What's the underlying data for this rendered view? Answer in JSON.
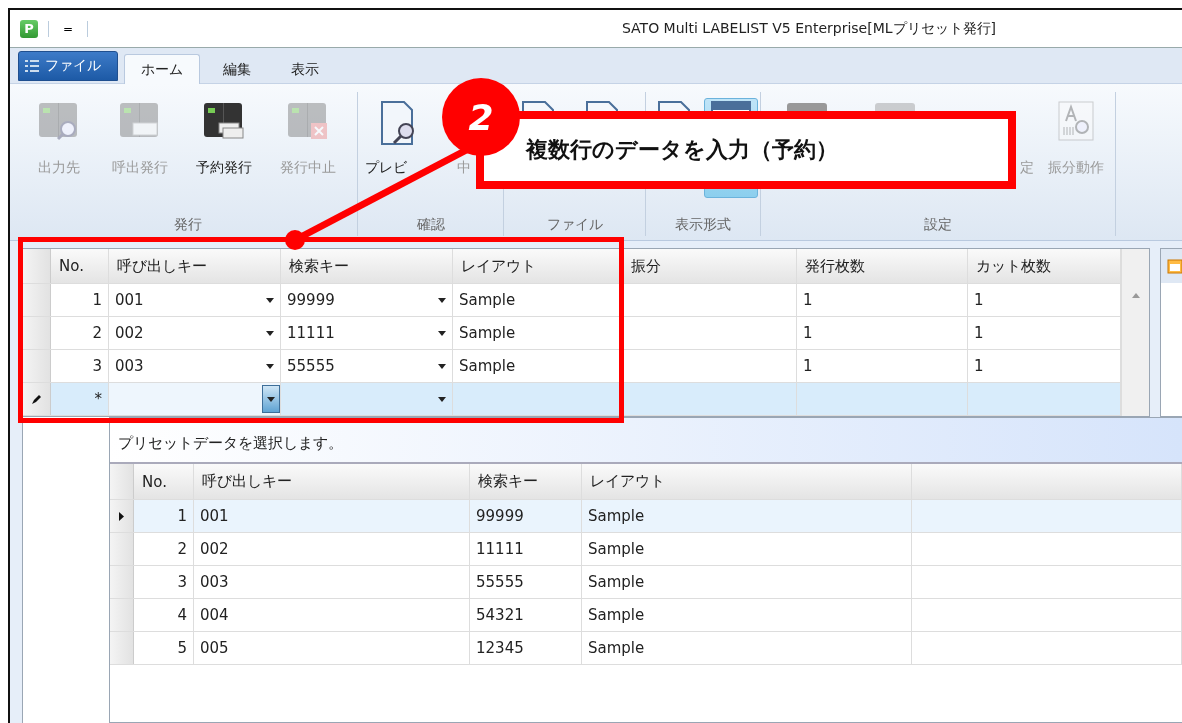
{
  "title_bar": {
    "app_icon": "P",
    "title": "SATO Multi LABELIST V5 Enterprise[MLプリセット発行]",
    "quick_access": "="
  },
  "tabs": [
    {
      "label": "ファイル",
      "kind": "file",
      "selected": false
    },
    {
      "label": "ホーム",
      "kind": "tab",
      "selected": true
    },
    {
      "label": "編集",
      "kind": "tab",
      "selected": false
    },
    {
      "label": "表示",
      "kind": "tab",
      "selected": false
    }
  ],
  "ribbon": {
    "groups": [
      {
        "label": "発行",
        "buttons": [
          {
            "label": "出力先",
            "kind": "printer-search",
            "disabled": true
          },
          {
            "label": "呼出発行",
            "kind": "printer-call",
            "disabled": true
          },
          {
            "label": "予約発行",
            "kind": "printer-queue",
            "disabled": false
          },
          {
            "label": "発行中止",
            "kind": "printer-stop",
            "disabled": true
          }
        ]
      },
      {
        "label": "確認",
        "buttons": [
          {
            "label": "プレビ",
            "kind": "preview",
            "disabled": false
          },
          {
            "label": "中",
            "kind": "blank",
            "disabled": true
          }
        ]
      },
      {
        "label": "ファイル",
        "buttons": [
          {
            "kind": "document"
          },
          {
            "kind": "document"
          }
        ]
      },
      {
        "label": "表示形式",
        "buttons": [
          {
            "kind": "document",
            "selected": false
          },
          {
            "kind": "view",
            "selected": true
          }
        ]
      },
      {
        "label": "設定",
        "buttons": [
          {
            "kind": "settings"
          },
          {
            "label": "定",
            "kind": "settings",
            "disabled": true
          },
          {
            "label": "振分動作",
            "kind": "layout-search",
            "disabled": true
          }
        ]
      }
    ]
  },
  "callout": {
    "number": "2",
    "text": "複数行のデータを入力（予約）"
  },
  "entry_grid": {
    "columns": [
      "No.",
      "呼び出しキー",
      "検索キー",
      "レイアウト",
      "振分",
      "発行枚数",
      "カット枚数"
    ],
    "rows": [
      {
        "cells": [
          "1",
          "001",
          "99999",
          "Sample",
          "",
          "1",
          "1"
        ]
      },
      {
        "cells": [
          "2",
          "002",
          "11111",
          "Sample",
          "",
          "1",
          "1"
        ]
      },
      {
        "cells": [
          "3",
          "003",
          "55555",
          "Sample",
          "",
          "1",
          "1"
        ]
      }
    ],
    "new_row": {
      "marker": "*",
      "editing": true
    }
  },
  "preset_panel": {
    "caption": "プリセットデータを選択します。",
    "columns": [
      "No.",
      "呼び出しキー",
      "検索キー",
      "レイアウト"
    ],
    "rows": [
      {
        "cells": [
          "1",
          "001",
          "99999",
          "Sample"
        ],
        "selected": true
      },
      {
        "cells": [
          "2",
          "002",
          "11111",
          "Sample"
        ],
        "selected": false
      },
      {
        "cells": [
          "3",
          "003",
          "55555",
          "Sample"
        ],
        "selected": false
      },
      {
        "cells": [
          "4",
          "004",
          "54321",
          "Sample"
        ],
        "selected": false
      },
      {
        "cells": [
          "5",
          "005",
          "12345",
          "Sample"
        ],
        "selected": false
      }
    ]
  }
}
